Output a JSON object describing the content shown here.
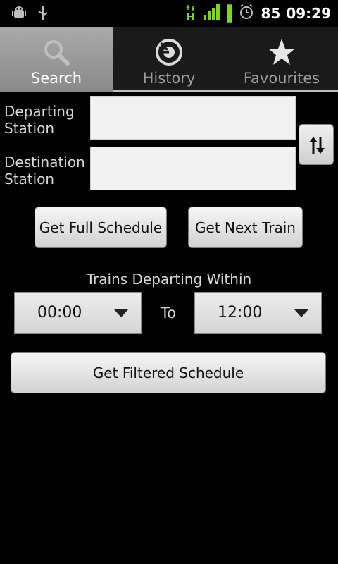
{
  "status_bar": {
    "battery_percent": "85",
    "time": "09:29",
    "network_type": "H"
  },
  "tabs": [
    {
      "label": "Search",
      "icon": "search-icon",
      "active": true
    },
    {
      "label": "History",
      "icon": "history-icon",
      "active": false
    },
    {
      "label": "Favourites",
      "icon": "star-icon",
      "active": false
    }
  ],
  "form": {
    "departing_label_1": "Departing",
    "departing_label_2": "Station",
    "departing_value": "",
    "destination_label_1": "Destination",
    "destination_label_2": "Station",
    "destination_value": ""
  },
  "buttons": {
    "full_schedule": "Get Full Schedule",
    "next_train": "Get Next Train",
    "filtered_schedule": "Get Filtered Schedule"
  },
  "filter": {
    "title": "Trains Departing Within",
    "from_value": "00:00",
    "to_label": "To",
    "to_value": "12:00"
  }
}
